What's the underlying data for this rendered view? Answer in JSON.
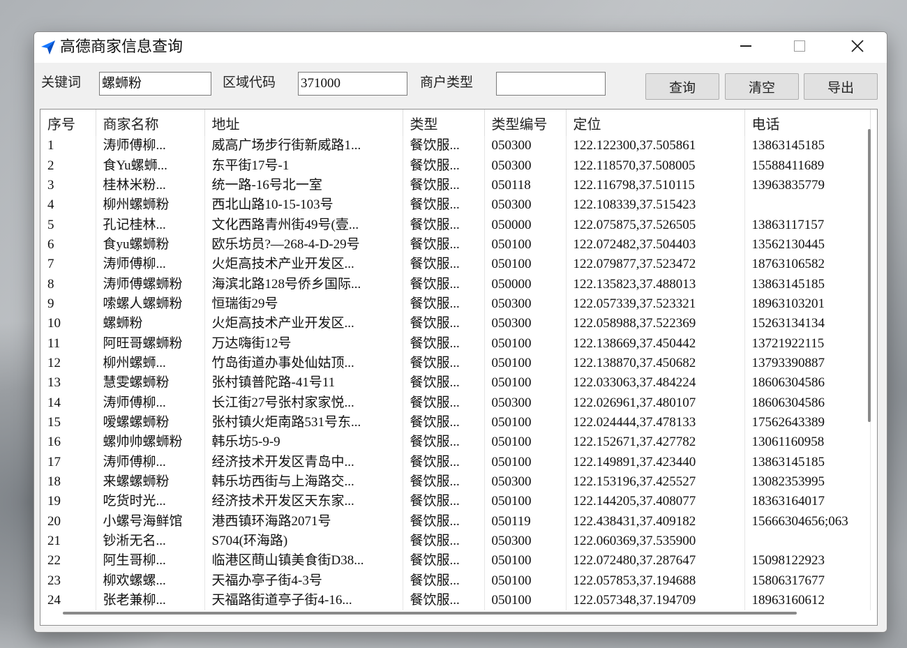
{
  "window": {
    "title": "高德商家信息查询"
  },
  "form": {
    "keyword_label": "关键词",
    "keyword_value": "螺蛳粉",
    "region_label": "区域代码",
    "region_value": "371000",
    "type_label": "商户类型",
    "type_value": ""
  },
  "buttons": {
    "query": "查询",
    "clear": "清空",
    "export": "导出"
  },
  "table": {
    "columns": [
      "序号",
      "商家名称",
      "地址",
      "类型",
      "类型编号",
      "定位",
      "电话"
    ],
    "rows": [
      [
        "1",
        "涛师傅柳...",
        "威高广场步行街新威路1...",
        "餐饮服...",
        "050300",
        "122.122300,37.505861",
        "13863145185"
      ],
      [
        "2",
        "食Yu螺蛳...",
        "东平街17号-1",
        "餐饮服...",
        "050300",
        "122.118570,37.508005",
        "15588411689"
      ],
      [
        "3",
        "桂林米粉...",
        "统一路-16号北一室",
        "餐饮服...",
        "050118",
        "122.116798,37.510115",
        "13963835779"
      ],
      [
        "4",
        "柳州螺蛳粉",
        "西北山路10-15-103号",
        "餐饮服...",
        "050300",
        "122.108339,37.515423",
        ""
      ],
      [
        "5",
        "孔记桂林...",
        "文化西路青州街49号(壹...",
        "餐饮服...",
        "050000",
        "122.075875,37.526505",
        "13863117157"
      ],
      [
        "6",
        "食yu螺蛳粉",
        "欧乐坊员?—268-4-D-29号",
        "餐饮服...",
        "050100",
        "122.072482,37.504403",
        "13562130445"
      ],
      [
        "7",
        "涛师傅柳...",
        "火炬高技术产业开发区...",
        "餐饮服...",
        "050100",
        "122.079877,37.523472",
        "18763106582"
      ],
      [
        "8",
        "涛师傅螺蛳粉",
        "海滨北路128号侨乡国际...",
        "餐饮服...",
        "050000",
        "122.135823,37.488013",
        "13863145185"
      ],
      [
        "9",
        "嗦螺人螺蛳粉",
        "恒瑞街29号",
        "餐饮服...",
        "050300",
        "122.057339,37.523321",
        "18963103201"
      ],
      [
        "10",
        "螺蛳粉",
        "火炬高技术产业开发区...",
        "餐饮服...",
        "050300",
        "122.058988,37.522369",
        "15263134134"
      ],
      [
        "11",
        "阿旺哥螺蛳粉",
        "万达嗨街12号",
        "餐饮服...",
        "050100",
        "122.138669,37.450442",
        "13721922115"
      ],
      [
        "12",
        "柳州螺蛳...",
        "竹岛街道办事处仙姑顶...",
        "餐饮服...",
        "050100",
        "122.138870,37.450682",
        "13793390887"
      ],
      [
        "13",
        "慧雯螺蛳粉",
        "张村镇普陀路-41号11",
        "餐饮服...",
        "050100",
        "122.033063,37.484224",
        "18606304586"
      ],
      [
        "14",
        "涛师傅柳...",
        "长江街27号张村家家悦...",
        "餐饮服...",
        "050300",
        "122.026961,37.480107",
        "18606304586"
      ],
      [
        "15",
        "嗳螺螺蛳粉",
        "张村镇火炬南路531号东...",
        "餐饮服...",
        "050100",
        "122.024444,37.478133",
        "17562643389"
      ],
      [
        "16",
        "螺帅帅螺蛳粉",
        "韩乐坊5-9-9",
        "餐饮服...",
        "050100",
        "122.152671,37.427782",
        "13061160958"
      ],
      [
        "17",
        "涛师傅柳...",
        "经济技术开发区青岛中...",
        "餐饮服...",
        "050100",
        "122.149891,37.423440",
        "13863145185"
      ],
      [
        "18",
        "来螺螺蛳粉",
        "韩乐坊西街与上海路交...",
        "餐饮服...",
        "050300",
        "122.153196,37.425527",
        "13082353995"
      ],
      [
        "19",
        "吃货时光...",
        "经济技术开发区天东家...",
        "餐饮服...",
        "050100",
        "122.144205,37.408077",
        "18363164017"
      ],
      [
        "20",
        "小螺号海鲜馆",
        "港西镇环海路2071号",
        "餐饮服...",
        "050119",
        "122.438431,37.409182",
        "15666304656;063"
      ],
      [
        "21",
        "钞淅无名...",
        "S704(环海路)",
        "餐饮服...",
        "050300",
        "122.060369,37.535900",
        ""
      ],
      [
        "22",
        "阿生哥柳...",
        "临港区蔄山镇美食街D38...",
        "餐饮服...",
        "050100",
        "122.072480,37.287647",
        "15098122923"
      ],
      [
        "23",
        "柳欢螺螺...",
        "天福办亭子街4-3号",
        "餐饮服...",
        "050100",
        "122.057853,37.194688",
        "15806317677"
      ],
      [
        "24",
        "张老兼柳...",
        "天福路街道亭子街4-16...",
        "餐饮服...",
        "050100",
        "122.057348,37.194709",
        "18963160612"
      ]
    ]
  }
}
